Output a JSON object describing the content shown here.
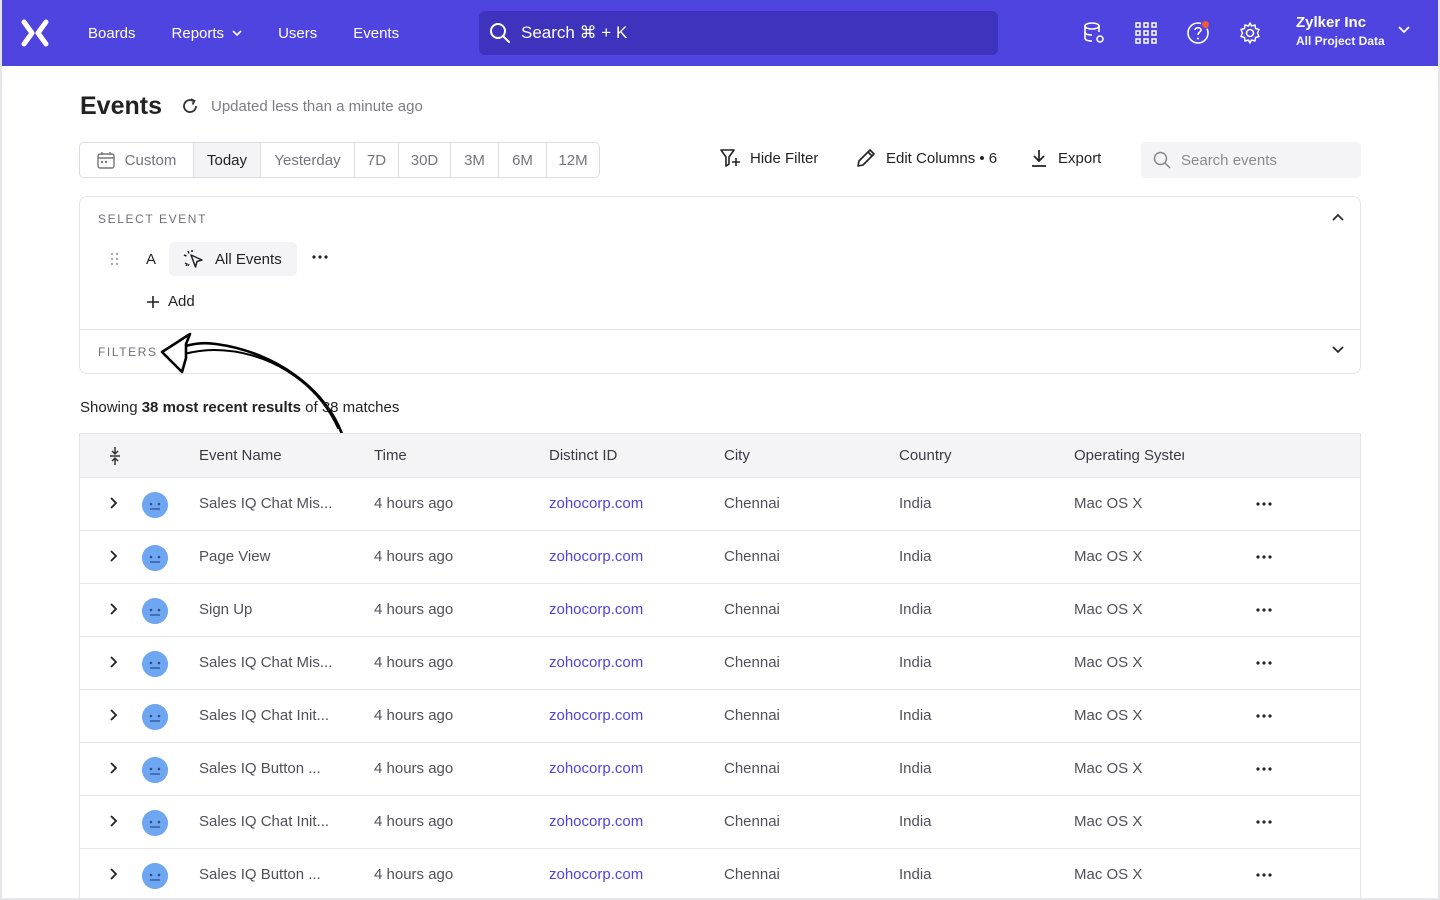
{
  "nav": {
    "items": [
      {
        "label": "Boards",
        "has_chevron": false
      },
      {
        "label": "Reports",
        "has_chevron": true
      },
      {
        "label": "Users",
        "has_chevron": false
      },
      {
        "label": "Events",
        "has_chevron": false
      }
    ],
    "search_label": "Search ⌘ + K",
    "icons": [
      "database-settings-icon",
      "apps-grid-icon",
      "help-icon",
      "settings-gear-icon"
    ],
    "account": {
      "org": "Zylker Inc",
      "project": "All Project Data"
    }
  },
  "page": {
    "title": "Events",
    "updated": "Updated less than a minute ago"
  },
  "date_range": {
    "options": [
      "Custom",
      "Today",
      "Yesterday",
      "7D",
      "30D",
      "3M",
      "6M",
      "12M"
    ],
    "selected": "Today"
  },
  "toolbar": {
    "hide_filter": "Hide Filter",
    "edit_columns": "Edit Columns • 6",
    "export": "Export",
    "search_placeholder": "Search events"
  },
  "select_event": {
    "label": "SELECT EVENT",
    "letter": "A",
    "event": "All Events",
    "add": "Add",
    "filters_label": "FILTERS"
  },
  "summary": {
    "prefix": "Showing ",
    "bold": "38 most recent results",
    "suffix": " of 38 matches"
  },
  "table": {
    "columns": [
      "Event Name",
      "Time",
      "Distinct ID",
      "City",
      "Country",
      "Operating System"
    ],
    "rows": [
      {
        "event": "Sales IQ Chat Mis...",
        "time": "4 hours ago",
        "distinct_id": "zohocorp.com",
        "city": "Chennai",
        "country": "India",
        "os": "Mac OS X"
      },
      {
        "event": "Page View",
        "time": "4 hours ago",
        "distinct_id": "zohocorp.com",
        "city": "Chennai",
        "country": "India",
        "os": "Mac OS X"
      },
      {
        "event": "Sign Up",
        "time": "4 hours ago",
        "distinct_id": "zohocorp.com",
        "city": "Chennai",
        "country": "India",
        "os": "Mac OS X"
      },
      {
        "event": "Sales IQ Chat Mis...",
        "time": "4 hours ago",
        "distinct_id": "zohocorp.com",
        "city": "Chennai",
        "country": "India",
        "os": "Mac OS X"
      },
      {
        "event": "Sales IQ Chat Init...",
        "time": "4 hours ago",
        "distinct_id": "zohocorp.com",
        "city": "Chennai",
        "country": "India",
        "os": "Mac OS X"
      },
      {
        "event": "Sales IQ Button ...",
        "time": "4 hours ago",
        "distinct_id": "zohocorp.com",
        "city": "Chennai",
        "country": "India",
        "os": "Mac OS X"
      },
      {
        "event": "Sales IQ Chat Init...",
        "time": "4 hours ago",
        "distinct_id": "zohocorp.com",
        "city": "Chennai",
        "country": "India",
        "os": "Mac OS X"
      },
      {
        "event": "Sales IQ Button ...",
        "time": "4 hours ago",
        "distinct_id": "zohocorp.com",
        "city": "Chennai",
        "country": "India",
        "os": "Mac OS X"
      }
    ]
  },
  "colors": {
    "brand": "#4f44e0",
    "link": "#4f44e0",
    "avatar": "#6fa6f2",
    "notification": "#f0583a"
  }
}
